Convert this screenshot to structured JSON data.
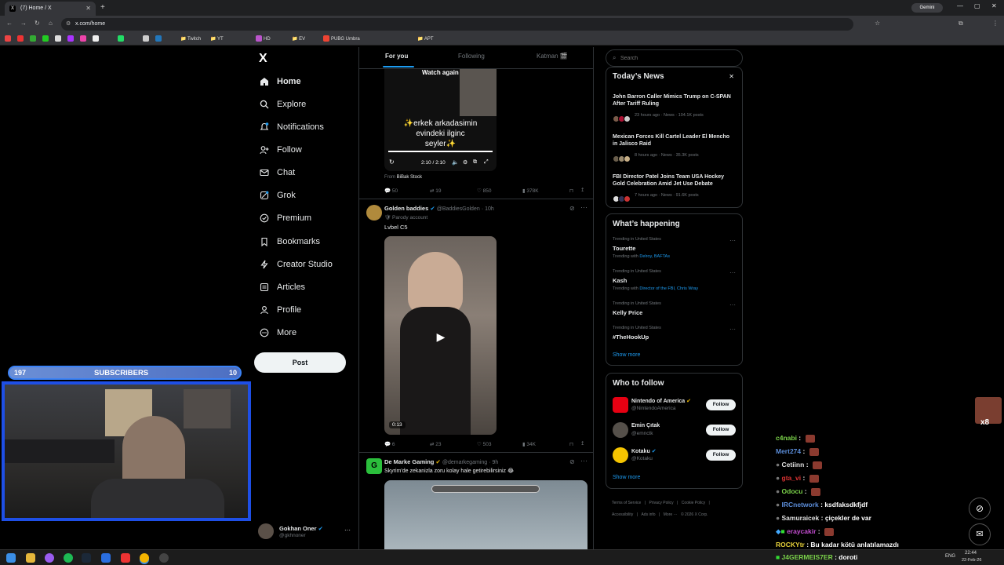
{
  "browser": {
    "tab_title": "(7) Home / X",
    "tab_close": "✕",
    "new_tab": "+",
    "url": "x.com/home",
    "gemini_label": "Gemini",
    "bookmarks": [
      "Twitch",
      "YT",
      "HD",
      "EV",
      "PUBG Umbra",
      "APT"
    ]
  },
  "nav": {
    "logo": "X",
    "items": [
      {
        "label": "Home",
        "icon": "home-icon"
      },
      {
        "label": "Explore",
        "icon": "search-icon"
      },
      {
        "label": "Notifications",
        "icon": "bell-icon"
      },
      {
        "label": "Follow",
        "icon": "person-plus-icon"
      },
      {
        "label": "Chat",
        "icon": "mail-icon"
      },
      {
        "label": "Grok",
        "icon": "grok-icon"
      },
      {
        "label": "Premium",
        "icon": "x-logo-icon"
      },
      {
        "label": "Bookmarks",
        "icon": "bookmark-icon"
      },
      {
        "label": "Creator Studio",
        "icon": "bolt-icon"
      },
      {
        "label": "Articles",
        "icon": "article-icon"
      },
      {
        "label": "Profile",
        "icon": "person-icon"
      },
      {
        "label": "More",
        "icon": "more-circle-icon"
      }
    ],
    "post_label": "Post",
    "account": {
      "name": "Gokhan Oner",
      "handle": "@gkhnoner",
      "more": "···"
    }
  },
  "timeline": {
    "tabs": [
      "For you",
      "Following",
      "Katman 🎬"
    ],
    "video_post": {
      "watch_again": "Watch again",
      "caption_line1": "✨erkek arkadasimin",
      "caption_line2": "evindeki ilginc",
      "caption_line3": "seyler✨",
      "time": "2:10 / 2:10",
      "from_label": "From",
      "from_source": "BiBak Stock",
      "replies": "50",
      "reposts": "19",
      "likes": "850",
      "views": "378K"
    },
    "post2": {
      "name": "Golden baddies",
      "handle": "@BaddiesGolden",
      "time": "· 10h",
      "parody": "🛡 Parody account",
      "text": "Lvbel C5",
      "duration": "0:13",
      "replies": "6",
      "reposts": "23",
      "likes": "503",
      "views": "34K"
    },
    "post3": {
      "name": "De Marke Gaming",
      "handle": "@demarkegaming",
      "time": "· 9h",
      "text": "Skyrim'de zekanizla zoru kolay hale getirebilirsiniz 😂"
    }
  },
  "sidebar": {
    "search_placeholder": "Search",
    "todays_news": {
      "title": "Today’s News",
      "close": "✕",
      "items": [
        {
          "title": "John Barron Caller Mimics Trump on C-SPAN After Tariff Ruling",
          "meta": "23 hours ago · News · 104.1K posts"
        },
        {
          "title": "Mexican Forces Kill Cartel Leader El Mencho in Jalisco Raid",
          "meta": "8 hours ago · News · 35.3K posts"
        },
        {
          "title": "FBI Director Patel Joins Team USA Hockey Gold Celebration Amid Jet Use Debate",
          "meta": "7 hours ago · News · 91.6K posts"
        }
      ]
    },
    "whats_happening": {
      "title": "What’s happening",
      "trends": [
        {
          "location": "Trending in United States",
          "name": "Tourette",
          "with_label": "Trending with",
          "with": "Delroy, BAFTAs"
        },
        {
          "location": "Trending in United States",
          "name": "Kash",
          "with_label": "Trending with",
          "with": "Director of the FBI, Chris Wray"
        },
        {
          "location": "Trending in United States",
          "name": "Kelly Price",
          "with_label": "",
          "with": ""
        },
        {
          "location": "Trending in United States",
          "name": "#TheHookUp",
          "with_label": "",
          "with": ""
        }
      ],
      "show_more": "Show more"
    },
    "who_to_follow": {
      "title": "Who to follow",
      "accounts": [
        {
          "name": "Nintendo of America",
          "handle": "@NintendoAmerica",
          "button": "Follow"
        },
        {
          "name": "Emin Çıtak",
          "handle": "@emnctk",
          "button": "Follow"
        },
        {
          "name": "Kotaku",
          "handle": "@Kotaku",
          "button": "Follow"
        }
      ],
      "show_more": "Show more"
    },
    "footer": [
      "Terms of Service",
      "Privacy Policy",
      "Cookie Policy",
      "Accessibility",
      "Ads info",
      "More ···",
      "© 2026 X Corp."
    ]
  },
  "stream": {
    "sub_count_left": "197",
    "sub_label": "SUBSCRIBERS",
    "sub_count_right": "10",
    "emote_count": "x8",
    "chat": [
      {
        "user": "c4nabi",
        "color": "#7bd34a",
        "msg": ""
      },
      {
        "user": "Mert274",
        "color": "#5b8dd9",
        "msg": ""
      },
      {
        "user": "Cetiinn",
        "color": "#e0e0e0",
        "msg": ""
      },
      {
        "user": "gta_vi",
        "color": "#d33",
        "msg": ""
      },
      {
        "user": "Odocu",
        "color": "#7bd34a",
        "msg": ""
      },
      {
        "user": "IRCnetwork",
        "color": "#5b8dd9",
        "msg": "ksdfaksdkfjdf"
      },
      {
        "user": "Samuraicek",
        "color": "#e0e0e0",
        "msg": "çiçekler de var"
      },
      {
        "user": "eraycakir",
        "color": "#c44dd1",
        "msg": ""
      },
      {
        "user": "ROCKYtr",
        "color": "#e8d23a",
        "msg": "Bu kadar kötü anlatılamazdı"
      },
      {
        "user": "J4GERMEIS7ER",
        "color": "#7bd34a",
        "msg": "doroti"
      }
    ]
  },
  "taskbar": {
    "lang": "ENG",
    "time": "22:44",
    "date": "22-Feb-26"
  }
}
